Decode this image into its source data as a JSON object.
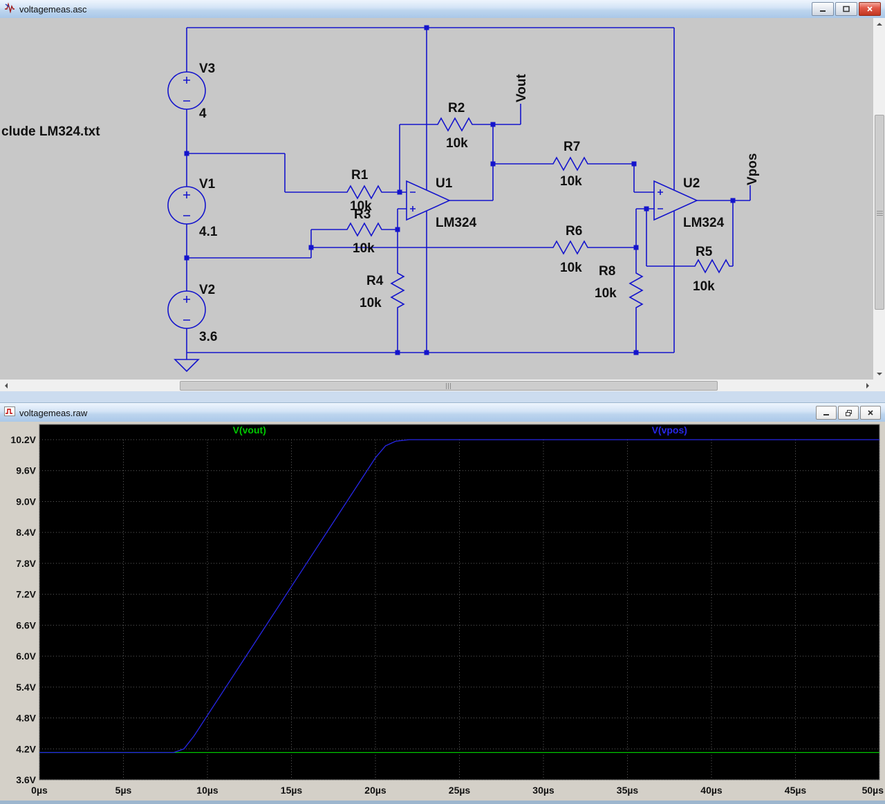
{
  "schematic_window": {
    "title": "voltagemeas.asc",
    "directive": "clude LM324.txt",
    "components": {
      "v3": {
        "name": "V3",
        "value": "4"
      },
      "v1": {
        "name": "V1",
        "value": "4.1"
      },
      "v2": {
        "name": "V2",
        "value": "3.6"
      },
      "r1": {
        "name": "R1",
        "value": "10k"
      },
      "r2": {
        "name": "R2",
        "value": "10k"
      },
      "r3": {
        "name": "R3",
        "value": "10k"
      },
      "r4": {
        "name": "R4",
        "value": "10k"
      },
      "r5": {
        "name": "R5",
        "value": "10k"
      },
      "r6": {
        "name": "R6",
        "value": "10k"
      },
      "r7": {
        "name": "R7",
        "value": "10k"
      },
      "r8": {
        "name": "R8",
        "value": "10k"
      },
      "u1": {
        "name": "U1",
        "model": "LM324"
      },
      "u2": {
        "name": "U2",
        "model": "LM324"
      }
    },
    "nets": {
      "vout": "Vout",
      "vpos": "Vpos"
    },
    "icons": [
      "ltspice-schematic-icon",
      "minimize-icon",
      "maximize-icon",
      "close-icon"
    ]
  },
  "waveform_window": {
    "title": "voltagemeas.raw",
    "icons": [
      "waveform-file-icon",
      "minimize-icon",
      "restore-icon",
      "close-icon"
    ]
  },
  "colors": {
    "wire_blue": "#1414cc",
    "schematic_bg": "#c8c8c8",
    "plot_bg": "#000000",
    "trace_green": "#00c800",
    "trace_blue": "#2727e8",
    "grid_gray": "#5e5e5e"
  },
  "chart_data": {
    "type": "line",
    "title": "",
    "xlabel": "",
    "ylabel": "",
    "xlim": [
      0,
      50
    ],
    "ylim": [
      3.6,
      10.2
    ],
    "grid": true,
    "legend_position": "top",
    "background": "#000000",
    "x_tick_values": [
      0,
      5,
      10,
      15,
      20,
      25,
      30,
      35,
      40,
      45,
      50
    ],
    "x_tick_labels": [
      "0µs",
      "5µs",
      "10µs",
      "15µs",
      "20µs",
      "25µs",
      "30µs",
      "35µs",
      "40µs",
      "45µs",
      "50µs"
    ],
    "y_tick_values": [
      3.6,
      4.2,
      4.8,
      5.4,
      6.0,
      6.6,
      7.2,
      7.8,
      8.4,
      9.0,
      9.6,
      10.2
    ],
    "y_tick_labels": [
      "3.6V",
      "4.2V",
      "4.8V",
      "5.4V",
      "6.0V",
      "6.6V",
      "7.2V",
      "7.8V",
      "8.4V",
      "9.0V",
      "9.6V",
      "10.2V"
    ],
    "series": [
      {
        "name": "V(vout)",
        "color": "#00c800",
        "x": [
          0,
          50
        ],
        "y": [
          4.13,
          4.13
        ]
      },
      {
        "name": "V(vpos)",
        "color": "#2727e8",
        "x": [
          0,
          8,
          8.6,
          9.2,
          10,
          11,
          12,
          13,
          14,
          15,
          16,
          17,
          18,
          19,
          20,
          20.6,
          21.2,
          22,
          50
        ],
        "y": [
          4.13,
          4.13,
          4.2,
          4.45,
          4.85,
          5.35,
          5.85,
          6.35,
          6.85,
          7.35,
          7.85,
          8.35,
          8.85,
          9.35,
          9.85,
          10.08,
          10.17,
          10.2,
          10.2
        ]
      }
    ]
  }
}
